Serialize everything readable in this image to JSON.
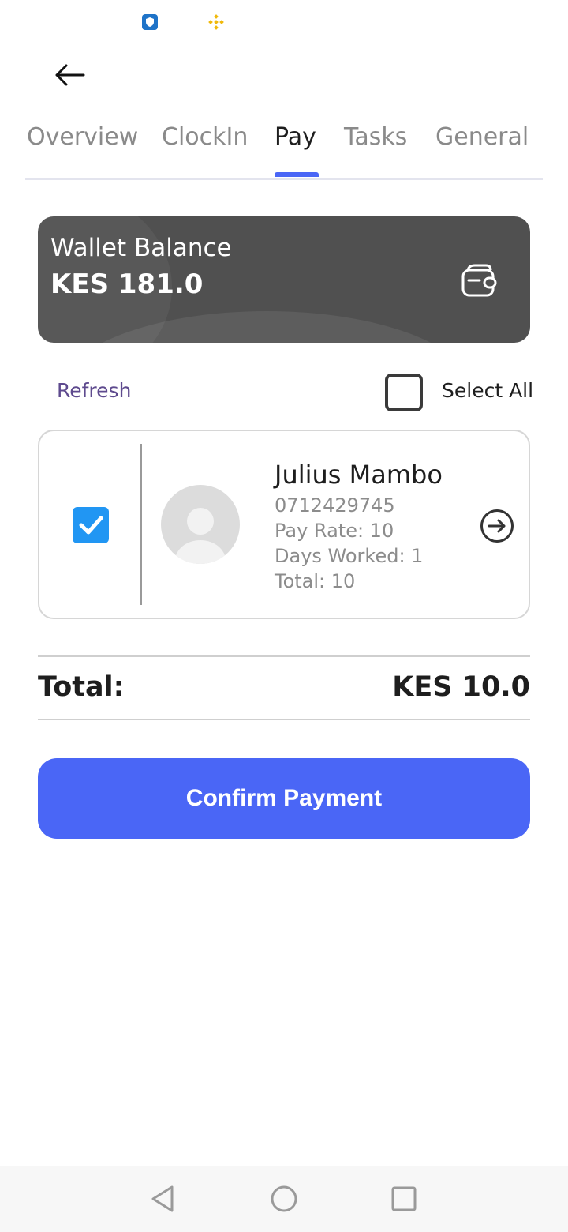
{
  "status_bar": {
    "icons": [
      "shield-app-icon",
      "binance-app-icon"
    ],
    "colors": {
      "shield": "#1e73c8",
      "binance": "#f0b90b"
    }
  },
  "header": {
    "back_icon": "arrow-left-icon"
  },
  "tabs": [
    {
      "label": "Overview",
      "active": false
    },
    {
      "label": "ClockIn",
      "active": false
    },
    {
      "label": "Pay",
      "active": true
    },
    {
      "label": "Tasks",
      "active": false
    },
    {
      "label": "General",
      "active": false
    }
  ],
  "wallet": {
    "title": "Wallet Balance",
    "amount": "KES 181.0",
    "icon": "wallet-icon"
  },
  "actions": {
    "refresh_label": "Refresh",
    "select_all_label": "Select All",
    "select_all_checked": false
  },
  "workers": [
    {
      "name": "Julius Mambo",
      "phone": "0712429745",
      "pay_rate": "Pay Rate: 10",
      "days_worked": "Days Worked: 1",
      "total": "Total: 10",
      "checked": true
    }
  ],
  "summary": {
    "total_label": "Total:",
    "total_value": "KES 10.0"
  },
  "confirm_button": {
    "label": "Confirm Payment"
  },
  "nav_bar": {
    "buttons": [
      "back-triangle-icon",
      "home-circle-icon",
      "recents-square-icon"
    ]
  },
  "colors": {
    "accent": "#4a66f6",
    "checkbox": "#2196f3",
    "wallet_card": "#505050",
    "refresh_text": "#5e4a8e"
  }
}
